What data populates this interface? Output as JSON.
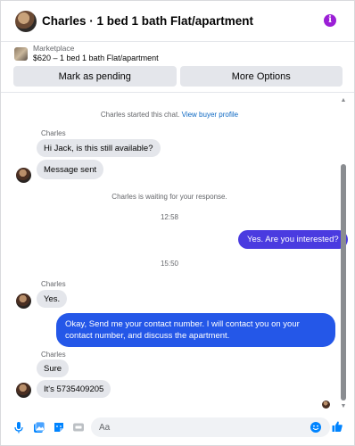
{
  "header": {
    "title": "Charles · 1 bed 1 bath Flat/apartment",
    "info_glyph": "i"
  },
  "listing": {
    "source_label": "Marketplace",
    "item": "$620 – 1 bed 1 bath Flat/apartment"
  },
  "actions": {
    "pending_label": "Mark as pending",
    "more_label": "More Options"
  },
  "chat": {
    "started_text": "Charles started this chat.",
    "view_profile_link": "View buyer profile",
    "waiting_text": "Charles is waiting for your response.",
    "time_1": "12:58",
    "time_2": "15:50",
    "sender_name": "Charles",
    "messages": [
      {
        "from": "Charles",
        "text": "Hi Jack, is this still available?"
      },
      {
        "from": "Charles",
        "text": "Message sent"
      },
      {
        "from": "me",
        "text": "Yes. Are you interested?"
      },
      {
        "from": "Charles",
        "text": "Yes."
      },
      {
        "from": "me",
        "text": "Okay, Send me your contact number. I will contact you on your contact number, and discuss the apartment."
      },
      {
        "from": "Charles",
        "text": "Sure"
      },
      {
        "from": "Charles",
        "text": "It's 5735409205"
      }
    ]
  },
  "composer": {
    "placeholder": "Aa",
    "icons": [
      "microphone-icon",
      "photo-icon",
      "sticker-icon",
      "gif-icon",
      "emoji-icon",
      "like-icon"
    ]
  },
  "colors": {
    "accent": "#0084ff",
    "outgoing_bubble": "#4a3be0",
    "outgoing_bubble_alt": "#2457e8",
    "incoming_bubble": "#e4e6eb",
    "info_icon": "#9b1fd6"
  }
}
